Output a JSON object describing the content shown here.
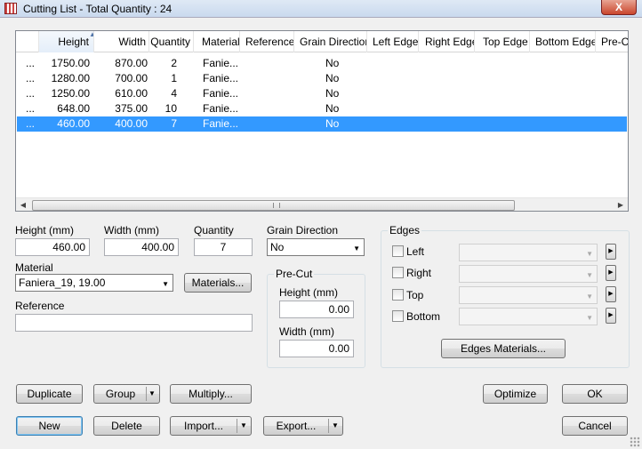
{
  "window": {
    "title": "Cutting List - Total Quantity : 24",
    "close_glyph": "X"
  },
  "grid": {
    "columns": [
      "Height",
      "Width",
      "Quantity",
      "Material",
      "Reference",
      "Grain Direction",
      "Left Edge",
      "Right Edge",
      "Top Edge",
      "Bottom Edge",
      "Pre-Cu"
    ],
    "rows": [
      {
        "handle": "...",
        "height": "1750.00",
        "width": "870.00",
        "quantity": "2",
        "material": "Fanie...",
        "reference": "",
        "grain": "No"
      },
      {
        "handle": "...",
        "height": "1280.00",
        "width": "700.00",
        "quantity": "1",
        "material": "Fanie...",
        "reference": "",
        "grain": "No"
      },
      {
        "handle": "...",
        "height": "1250.00",
        "width": "610.00",
        "quantity": "4",
        "material": "Fanie...",
        "reference": "",
        "grain": "No"
      },
      {
        "handle": "...",
        "height": "648.00",
        "width": "375.00",
        "quantity": "10",
        "material": "Fanie...",
        "reference": "",
        "grain": "No"
      },
      {
        "handle": "...",
        "height": "460.00",
        "width": "400.00",
        "quantity": "7",
        "material": "Fanie...",
        "reference": "",
        "grain": "No"
      }
    ],
    "selected_row": 4,
    "sorted_column": "Height"
  },
  "form": {
    "height_label": "Height (mm)",
    "height_value": "460.00",
    "width_label": "Width (mm)",
    "width_value": "400.00",
    "quantity_label": "Quantity",
    "quantity_value": "7",
    "grain_label": "Grain Direction",
    "grain_value": "No",
    "material_label": "Material",
    "material_value": "Faniera_19, 19.00",
    "materials_button": "Materials...",
    "reference_label": "Reference",
    "reference_value": ""
  },
  "precut": {
    "legend": "Pre-Cut",
    "height_label": "Height (mm)",
    "height_value": "0.00",
    "width_label": "Width (mm)",
    "width_value": "0.00"
  },
  "edges": {
    "legend": "Edges",
    "items": [
      {
        "label": "Left",
        "checked": false,
        "value": ""
      },
      {
        "label": "Right",
        "checked": false,
        "value": ""
      },
      {
        "label": "Top",
        "checked": false,
        "value": ""
      },
      {
        "label": "Bottom",
        "checked": false,
        "value": ""
      }
    ],
    "materials_button": "Edges Materials..."
  },
  "buttons": {
    "duplicate": "Duplicate",
    "group": "Group",
    "multiply": "Multiply...",
    "optimize": "Optimize",
    "ok": "OK",
    "new": "New",
    "delete": "Delete",
    "import": "Import...",
    "export": "Export...",
    "cancel": "Cancel"
  },
  "colors": {
    "selection": "#3399ff",
    "window_bg": "#f0f0f0",
    "close_button": "#c9452c"
  }
}
